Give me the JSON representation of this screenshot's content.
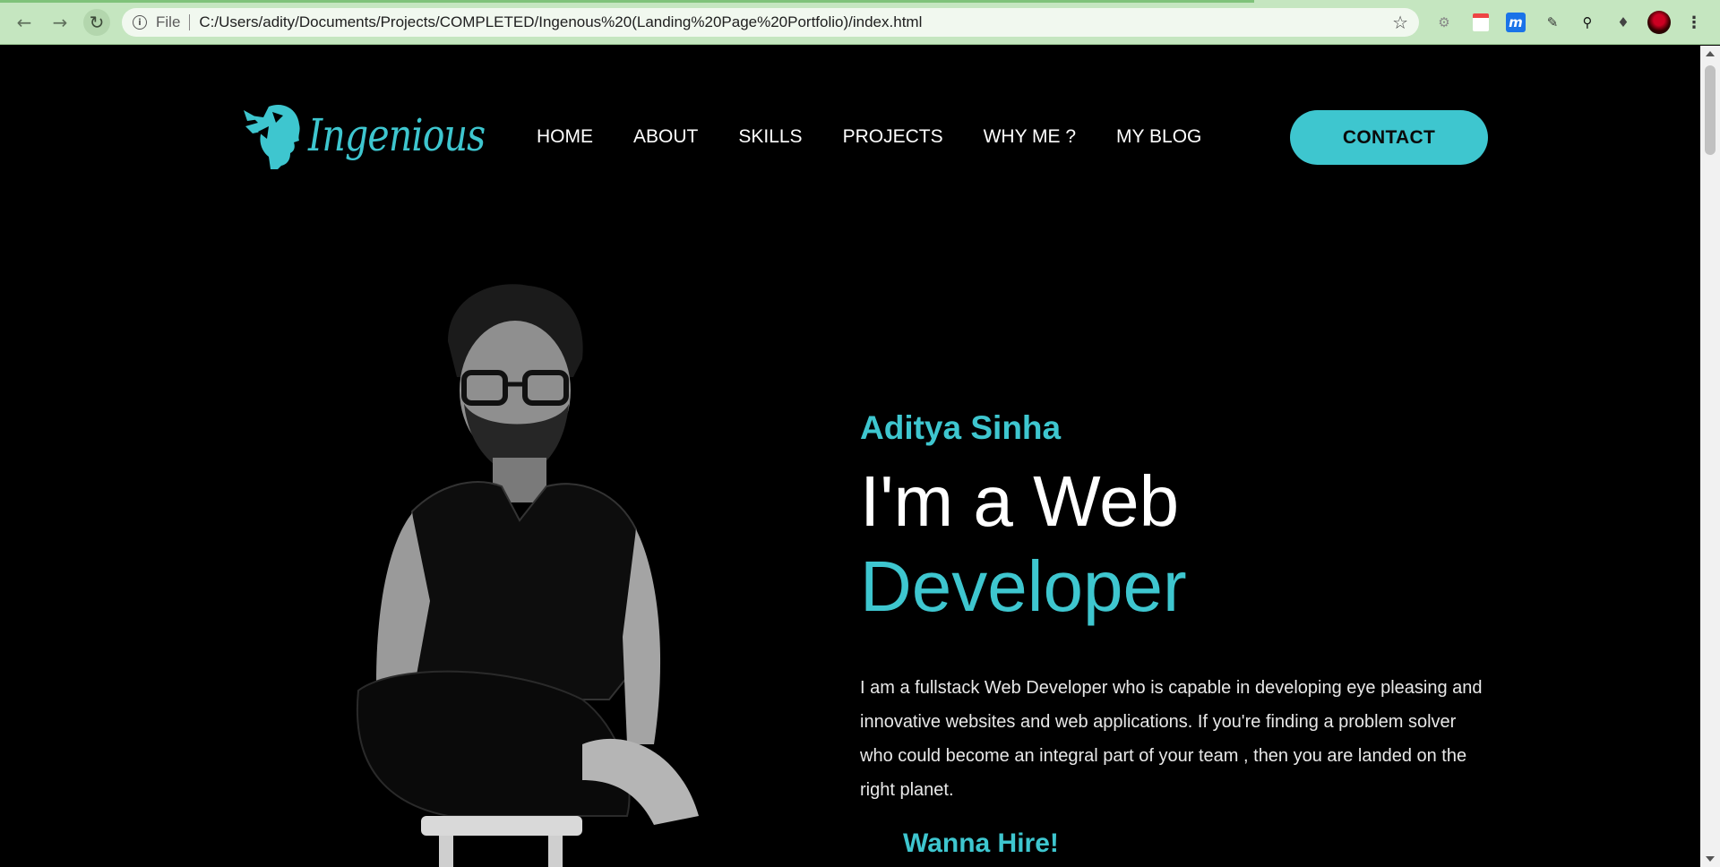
{
  "browser": {
    "scheme_label": "File",
    "url": "C:/Users/adity/Documents/Projects/COMPLETED/Ingenous%20(Landing%20Page%20Portfolio)/index.html",
    "extensions": [
      "settings-extension-icon",
      "calendar-extension-icon",
      "m-extension-icon",
      "pen-extension-icon",
      "magnifier-extension-icon",
      "puzzle-extensions-icon",
      "profile-avatar",
      "browser-menu-icon"
    ]
  },
  "site": {
    "brand": "Ingenious",
    "nav": [
      {
        "label": "HOME"
      },
      {
        "label": "ABOUT"
      },
      {
        "label": "SKILLS"
      },
      {
        "label": "PROJECTS"
      },
      {
        "label": "WHY ME ?"
      },
      {
        "label": "MY BLOG"
      }
    ],
    "contact_label": "CONTACT",
    "accent_color": "#3ec6cf"
  },
  "hero": {
    "name": "Aditya Sinha",
    "title_line1": "I'm a Web",
    "title_line2": "Developer",
    "description": "I am a fullstack Web Developer who is capable in developing eye pleasing and innovative websites and web applications. If you're finding a problem solver who could become an integral part of your team , then you are landed on the right planet.",
    "cta": "Wanna Hire!"
  }
}
